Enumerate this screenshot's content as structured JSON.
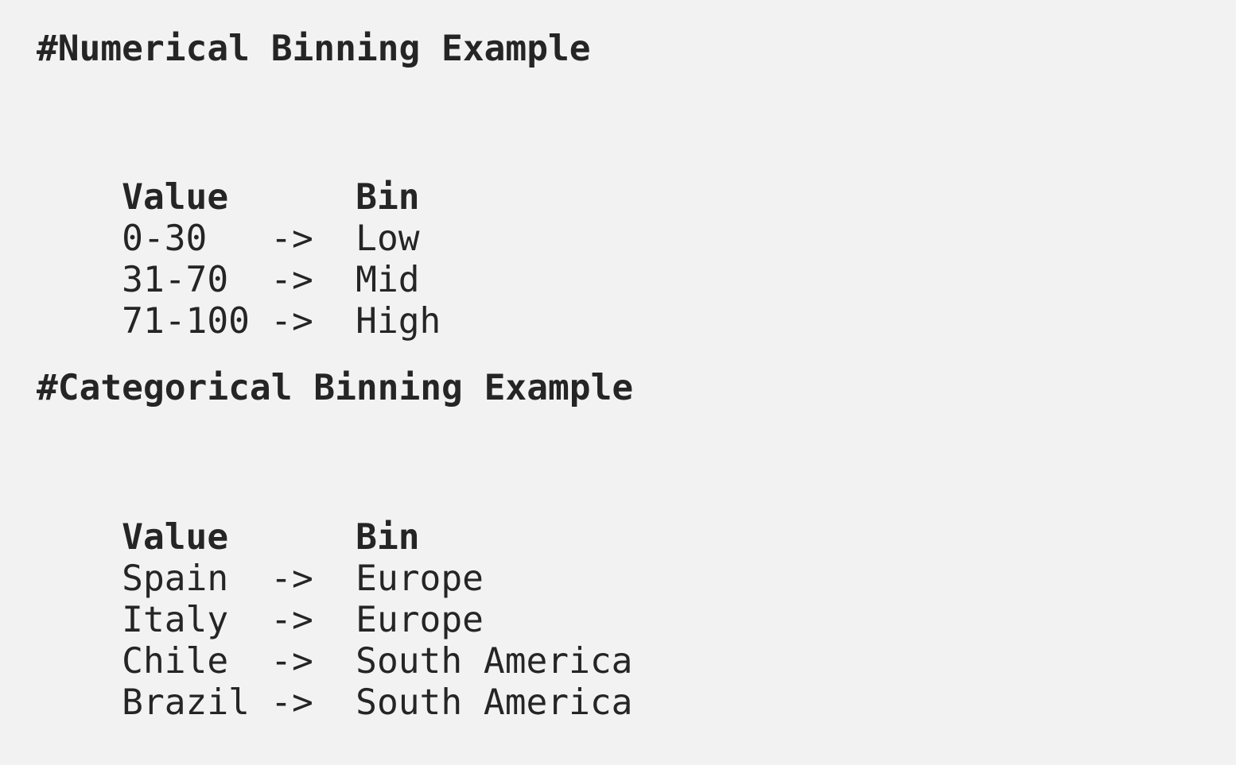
{
  "sections": [
    {
      "heading": "#Numerical Binning Example",
      "header": {
        "value": "Value",
        "bin": "Bin"
      },
      "rows": [
        {
          "value": "0-30",
          "arrow": "->",
          "bin": "Low"
        },
        {
          "value": "31-70",
          "arrow": "->",
          "bin": "Mid"
        },
        {
          "value": "71-100",
          "arrow": "->",
          "bin": "High"
        }
      ]
    },
    {
      "heading": "#Categorical Binning Example",
      "header": {
        "value": "Value",
        "bin": "Bin"
      },
      "rows": [
        {
          "value": "Spain",
          "arrow": "->",
          "bin": "Europe"
        },
        {
          "value": "Italy",
          "arrow": "->",
          "bin": "Europe"
        },
        {
          "value": "Chile",
          "arrow": "->",
          "bin": "South America"
        },
        {
          "value": "Brazil",
          "arrow": "->",
          "bin": "South America"
        }
      ]
    }
  ]
}
